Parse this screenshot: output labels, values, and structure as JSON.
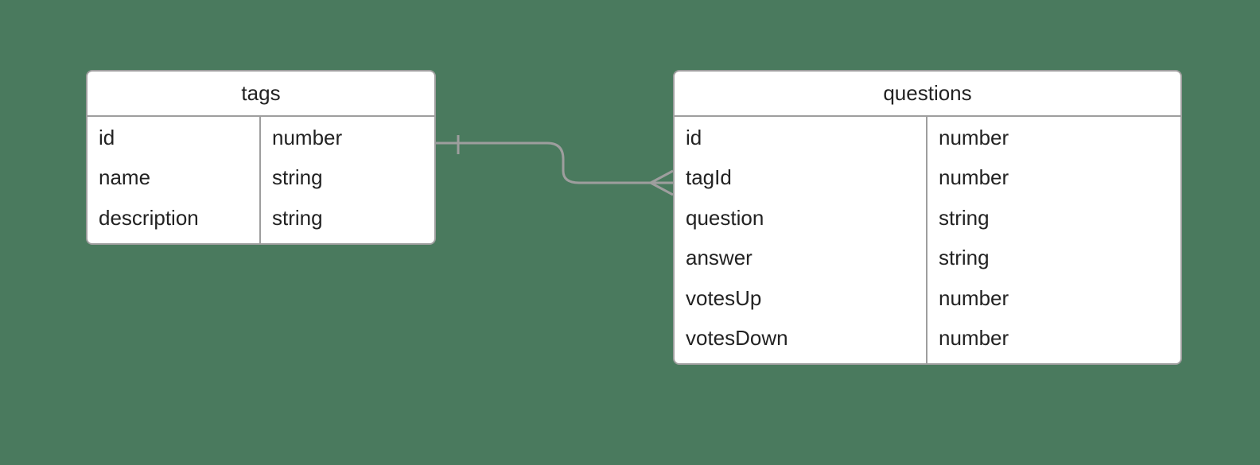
{
  "entities": {
    "tags": {
      "title": "tags",
      "fields": [
        {
          "name": "id",
          "type": "number"
        },
        {
          "name": "name",
          "type": "string"
        },
        {
          "name": "description",
          "type": "string"
        }
      ]
    },
    "questions": {
      "title": "questions",
      "fields": [
        {
          "name": "id",
          "type": "number"
        },
        {
          "name": "tagId",
          "type": "number"
        },
        {
          "name": "question",
          "type": "string"
        },
        {
          "name": "answer",
          "type": "string"
        },
        {
          "name": "votesUp",
          "type": "number"
        },
        {
          "name": "votesDown",
          "type": "number"
        }
      ]
    }
  },
  "relation": {
    "from": "tags",
    "to": "questions",
    "from_cardinality": "one",
    "to_cardinality": "many"
  }
}
